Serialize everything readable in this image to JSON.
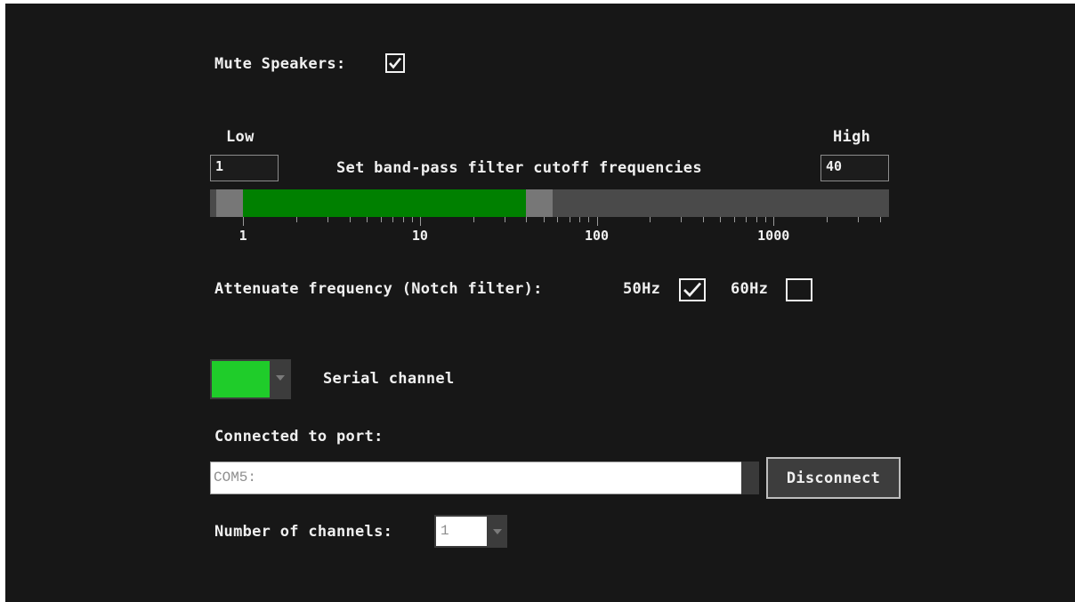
{
  "mute": {
    "label": "Mute Speakers:",
    "checked": true
  },
  "filter": {
    "low_label": "Low",
    "high_label": "High",
    "low_value": "1",
    "high_value": "40",
    "title": "Set band-pass filter cutoff frequencies",
    "range_low_hz": 1,
    "range_high_hz": 40,
    "axis_min_hz": 0.65,
    "axis_max_hz": 4500,
    "scale": "log",
    "tick_labels": [
      "1",
      "10",
      "100",
      "1000"
    ],
    "colors": {
      "selected": "#008000",
      "handle": "#777777",
      "track": "#4a4a4a"
    }
  },
  "notch": {
    "label": "Attenuate frequency (Notch filter):",
    "option_50_label": "50Hz",
    "option_50_checked": true,
    "option_60_label": "60Hz",
    "option_60_checked": false
  },
  "serial": {
    "label": "Serial channel",
    "swatch_color": "#1fcc2a"
  },
  "connection": {
    "label": "Connected to port:",
    "port_value": "COM5:",
    "disconnect_label": "Disconnect"
  },
  "channels": {
    "label": "Number of channels:",
    "value": "1"
  }
}
